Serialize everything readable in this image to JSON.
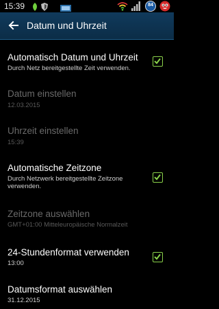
{
  "status_bar": {
    "time": "15:39",
    "battery_level": "84",
    "icons": [
      "leaf-icon",
      "shield-icon",
      "box-icon",
      "wifi-icon",
      "signal-icon",
      "battery-icon",
      "face-icon"
    ]
  },
  "action_bar": {
    "title": "Datum und Uhrzeit",
    "back_icon": "arrow-back-icon"
  },
  "settings": {
    "auto_datetime": {
      "title": "Automatisch Datum und Uhrzeit",
      "summary": "Durch Netz bereitgestellte Zeit verwenden.",
      "checked": true
    },
    "set_date": {
      "title": "Datum einstellen",
      "summary": "12.03.2015",
      "enabled": false
    },
    "set_time": {
      "title": "Uhrzeit einstellen",
      "summary": "15:39",
      "enabled": false
    },
    "auto_timezone": {
      "title": "Automatische Zeitzone",
      "summary": "Durch Netzwerk bereitgestellte Zeitzone verwenden.",
      "checked": true
    },
    "select_timezone": {
      "title": "Zeitzone auswählen",
      "summary": "GMT+01:00 Mitteleuropäische Normalzeit",
      "enabled": false
    },
    "format_24h": {
      "title": "24-Stundenformat verwenden",
      "summary": "13:00",
      "checked": true
    },
    "date_format": {
      "title": "Datumsformat auswählen",
      "summary": "31.12.2015"
    }
  },
  "colors": {
    "accent": "#8bd44b",
    "action_bar": "#0f3654"
  }
}
